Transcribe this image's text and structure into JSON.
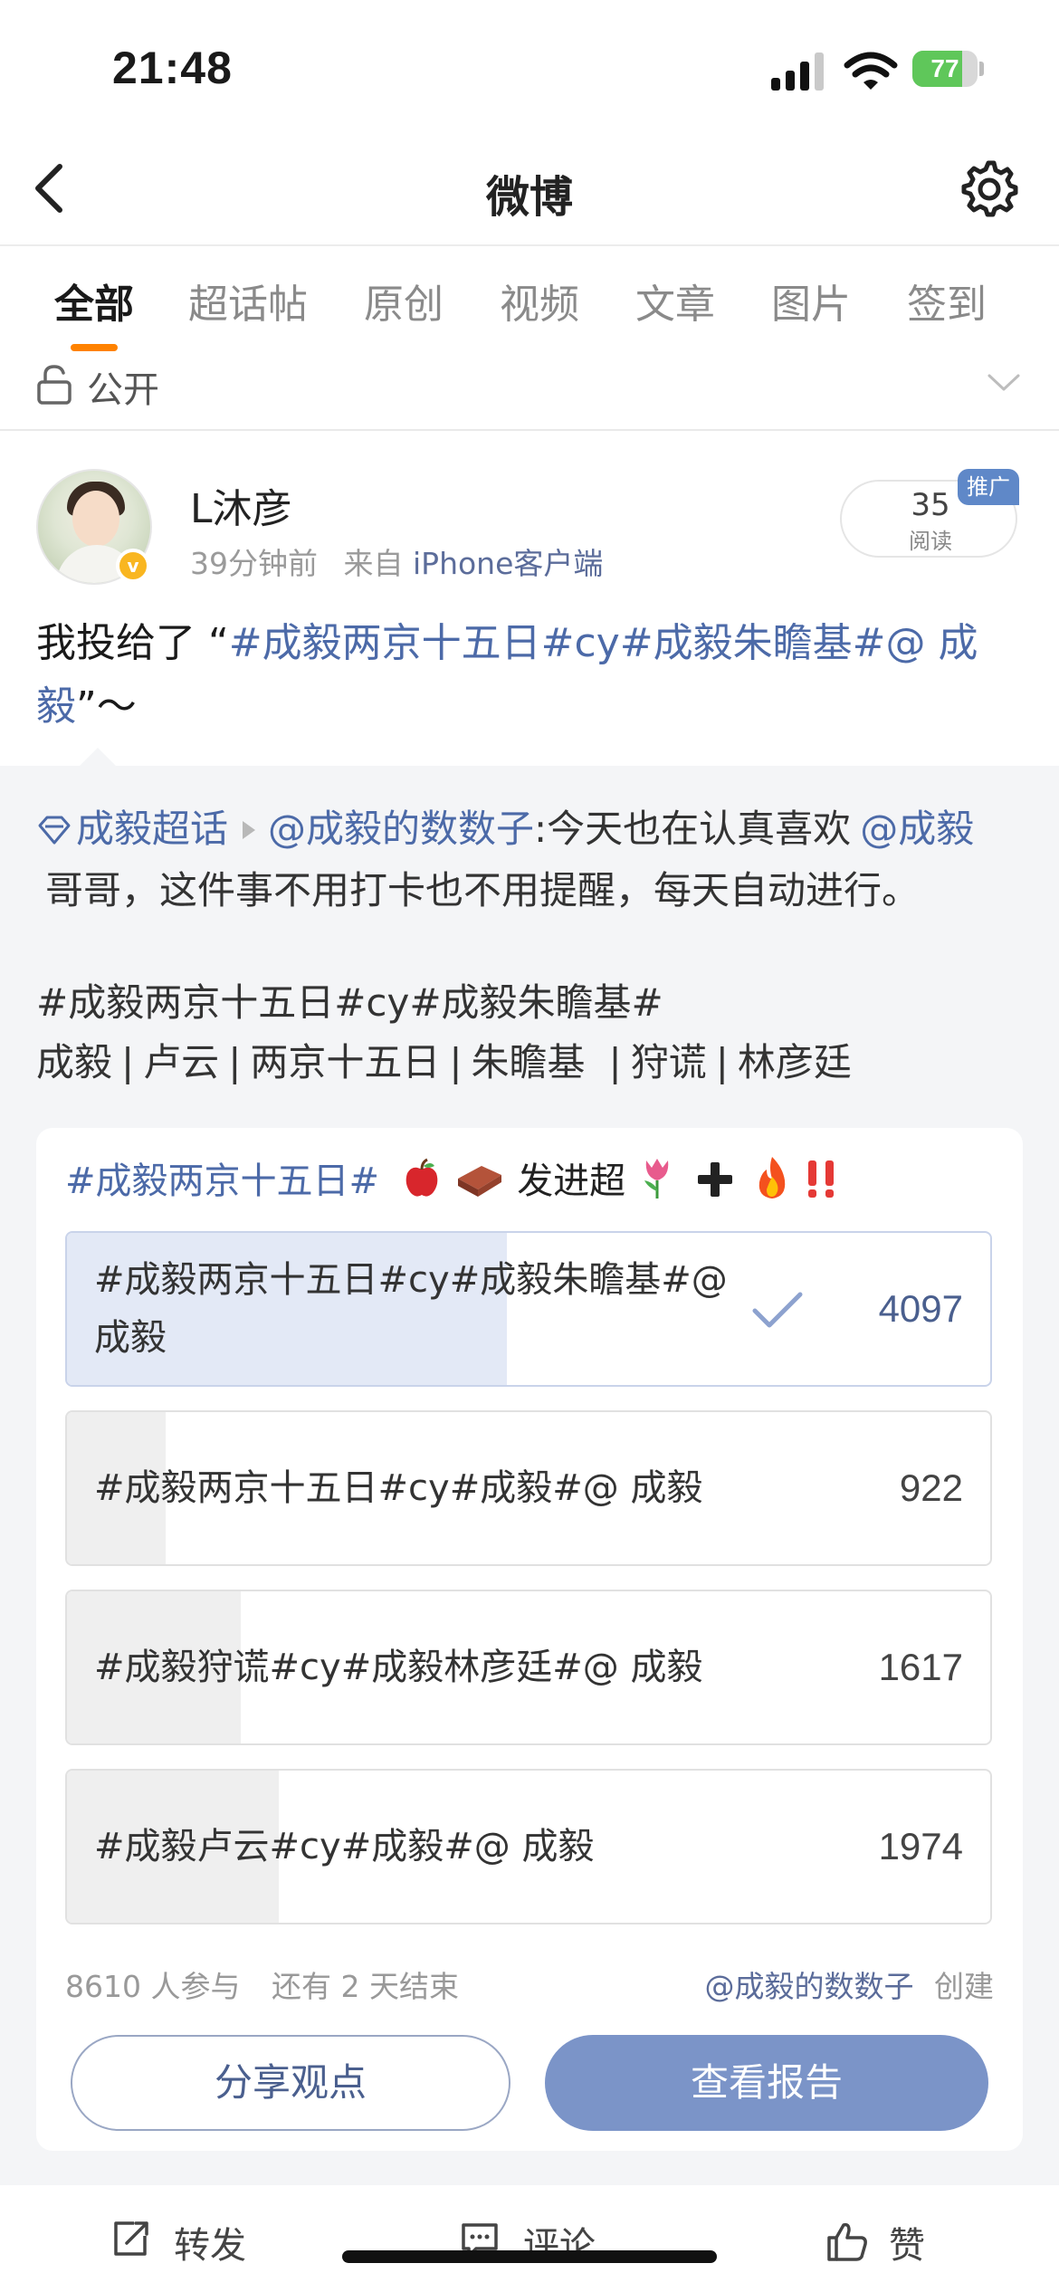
{
  "status_bar": {
    "time": "21:48",
    "battery": "77",
    "battery_level": 0.77
  },
  "nav": {
    "title": "微博"
  },
  "tabs": [
    {
      "label": "全部",
      "active": true
    },
    {
      "label": "超话帖"
    },
    {
      "label": "原创"
    },
    {
      "label": "视频"
    },
    {
      "label": "文章"
    },
    {
      "label": "图片"
    },
    {
      "label": "签到"
    }
  ],
  "privacy": {
    "label": "公开"
  },
  "post": {
    "user_name": "L沐彦",
    "time_ago": "39分钟前",
    "source_prefix": "来自",
    "source": "iPhone客户端",
    "reads_count": "35",
    "reads_label": "阅读",
    "promo": "推广",
    "text_prefix": "我投给了 “",
    "text_topic": "#成毅两京十五日#cy#成毅朱瞻基#@ 成毅",
    "text_suffix": "”～"
  },
  "retweet": {
    "supertopic": "成毅超话",
    "author": "@成毅的数数子",
    "line1_text": ":今天也在认真喜欢",
    "mention": "@成毅",
    "line2_text": "哥哥，这件事不用打卡也不用提醒，每天自动进行。",
    "topic_line": "#成毅两京十五日#cy#成毅朱瞻基#",
    "tags": [
      "成毅",
      "卢云",
      "两京十五日",
      "朱瞻基",
      "狩谎",
      "林彦廷"
    ]
  },
  "poll": {
    "title_topic": "#成毅两京十五日#",
    "title_text": "发进超",
    "options": [
      {
        "text": "#成毅两京十五日#cy#成毅朱瞻基#@ 成毅",
        "count": "4097",
        "share": 0.476,
        "voted": true
      },
      {
        "text": "#成毅两京十五日#cy#成毅#@ 成毅",
        "count": "922",
        "share": 0.107
      },
      {
        "text": "#成毅狩谎#cy#成毅林彦廷#@ 成毅",
        "count": "1617",
        "share": 0.188
      },
      {
        "text": "#成毅卢云#cy#成毅#@ 成毅",
        "count": "1974",
        "share": 0.229
      }
    ],
    "participants": "8610 人参与",
    "remaining": "还有 2 天结束",
    "creator": "@成毅的数数子",
    "creator_suffix": "创建",
    "share_button": "分享观点",
    "report_button": "查看报告"
  },
  "actions": {
    "repost": "转发",
    "comment": "评论",
    "like": "赞"
  },
  "colors": {
    "accent_orange": "#ff8200",
    "topic_blue": "#4c6aa8",
    "report_button": "#7b94c8",
    "vote_fill": "#e3e9f6",
    "battery_green": "#5fc75a"
  },
  "icons": [
    "signal-icon",
    "wifi-icon",
    "battery-icon",
    "back-icon",
    "settings-icon",
    "lock-icon",
    "chevron-down-icon",
    "verified-icon",
    "diamond-icon",
    "check-icon",
    "repost-icon",
    "comment-icon",
    "like-icon"
  ]
}
